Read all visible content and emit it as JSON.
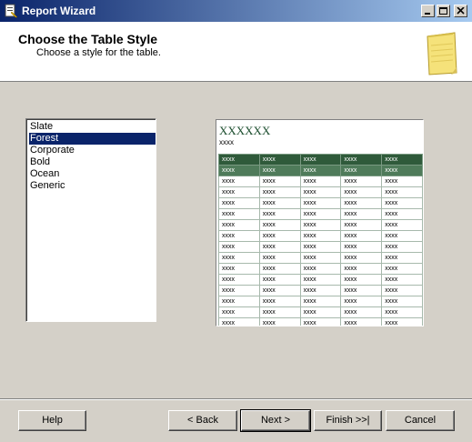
{
  "window": {
    "title": "Report Wizard"
  },
  "header": {
    "title": "Choose the Table Style",
    "subtitle": "Choose a style for the table."
  },
  "styles": {
    "items": [
      "Slate",
      "Forest",
      "Corporate",
      "Bold",
      "Ocean",
      "Generic"
    ],
    "selected": "Forest"
  },
  "preview": {
    "title": "XXXXXX",
    "subtitle": "xxxx",
    "cell": "xxxx",
    "colors": {
      "header": "#2f5a3a",
      "header2": "#4f7b5a",
      "title": "#1d4f2f"
    }
  },
  "buttons": {
    "help": "Help",
    "back": "< Back",
    "next": "Next >",
    "finish": "Finish >>|",
    "cancel": "Cancel"
  }
}
